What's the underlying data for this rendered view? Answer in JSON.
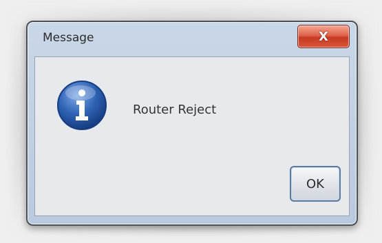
{
  "dialog": {
    "title": "Message",
    "close_label": "X",
    "message": "Router Reject",
    "icon": "information-icon",
    "ok_label": "OK"
  },
  "colors": {
    "frame": "#b9cadf",
    "client": "#e8e9ec",
    "close_button": "#d9553b",
    "icon_blue": "#2a5fb0"
  }
}
